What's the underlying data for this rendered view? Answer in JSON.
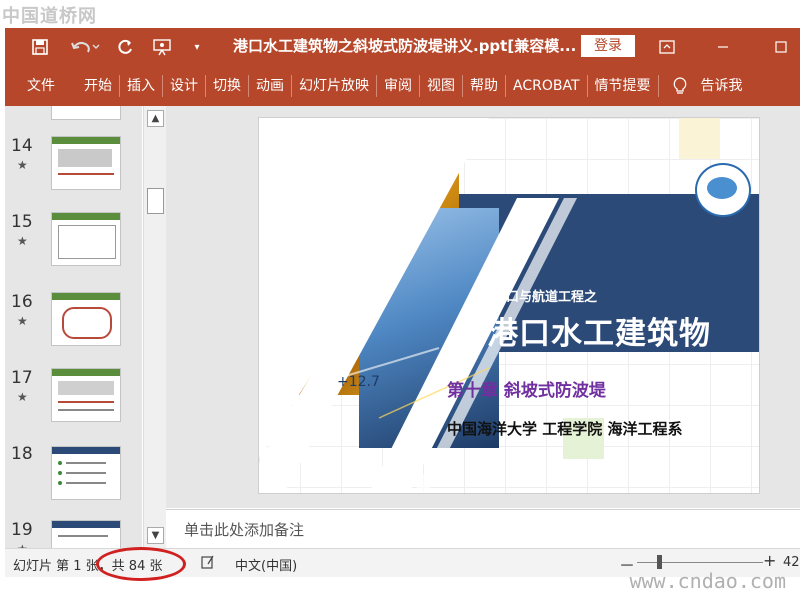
{
  "watermark_top": "中国道桥网",
  "watermark_bottom": "www.cndao.com",
  "titlebar": {
    "doc_title": "港口水工建筑物之斜坡式防波堤讲义.ppt[兼容模...",
    "login": "登录"
  },
  "ribbon": [
    "文件",
    "开始",
    "插入",
    "设计",
    "切换",
    "动画",
    "幻灯片放映",
    "审阅",
    "视图",
    "帮助",
    "ACROBAT",
    "情节提要",
    "告诉我"
  ],
  "thumbnails": [
    {
      "num": "14",
      "star": "★"
    },
    {
      "num": "15",
      "star": "★"
    },
    {
      "num": "16",
      "star": "★"
    },
    {
      "num": "17",
      "star": "★"
    },
    {
      "num": "18",
      "star": ""
    },
    {
      "num": "19",
      "star": "★"
    }
  ],
  "slide": {
    "subtitle": "港口与航道工程之",
    "title": "港口水工建筑物",
    "chapter": "第十章  斜坡式防波堤",
    "institution": "中国海洋大学 工程学院 海洋工程系"
  },
  "notes_placeholder": "单击此处添加备注",
  "status": {
    "slide_info": "幻灯片 第 1 张，共 84 张",
    "language": "中文(中国)",
    "zoom_minus": "－",
    "zoom_plus": "+",
    "zoom": "42"
  },
  "colors": {
    "accent": "#b7472a",
    "slide_band": "#2b4a78",
    "chapter": "#7030a0",
    "highlight": "#d02020"
  }
}
